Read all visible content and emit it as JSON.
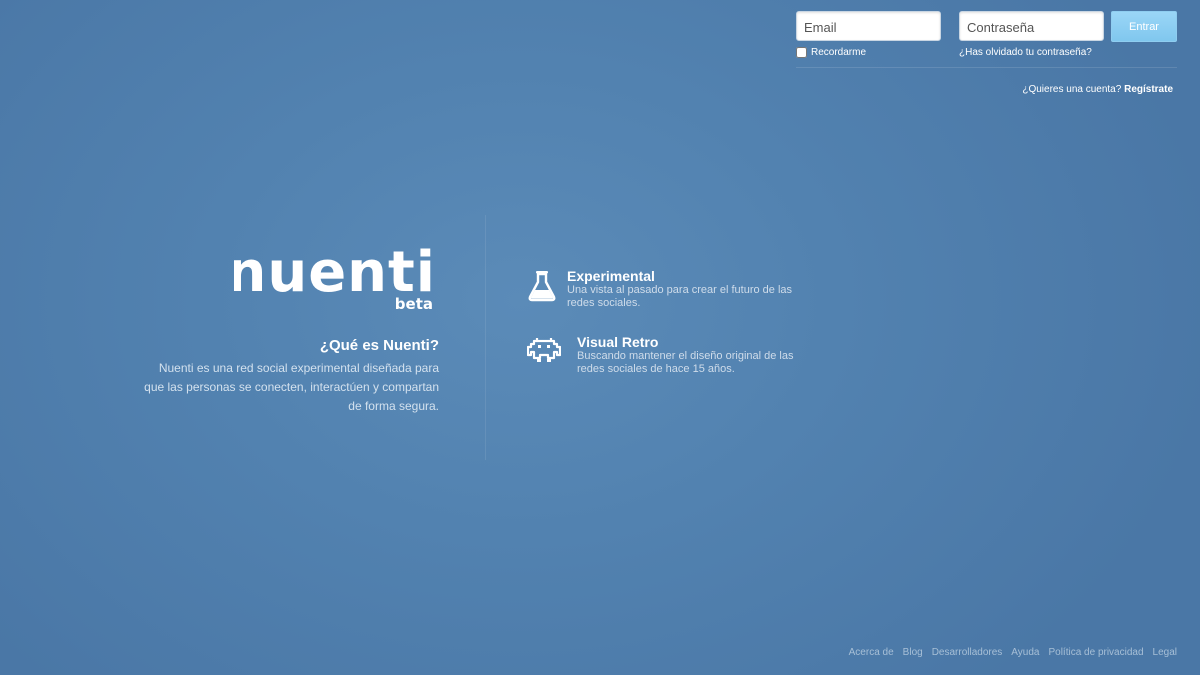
{
  "login": {
    "email_placeholder": "Email",
    "password_placeholder": "Contraseña",
    "submit_label": "Entrar",
    "remember_label": "Recordarme",
    "forgot_label": "¿Has olvidado tu contraseña?",
    "signup_prompt": "¿Quieres una cuenta?",
    "signup_link": "Regístrate"
  },
  "brand": {
    "logo_word": "nuenti",
    "logo_tag": "beta"
  },
  "about": {
    "title": "¿Qué es Nuenti?",
    "text": "Nuenti es una red social experimental diseñada para que las personas se conecten, interactúen y compartan de forma segura."
  },
  "features": [
    {
      "icon": "flask-icon",
      "title": "Experimental",
      "description": "Una vista al pasado para crear el futuro de las redes sociales."
    },
    {
      "icon": "space-invader-icon",
      "title": "Visual Retro",
      "description": "Buscando mantener el diseño original de las redes sociales de hace 15 años."
    }
  ],
  "footer": {
    "links": [
      "Acerca de",
      "Blog",
      "Desarrolladores",
      "Ayuda",
      "Política de privacidad",
      "Legal"
    ]
  },
  "colors": {
    "background": "#5282b0",
    "button": "#8ecff3",
    "footer_link": "#a7bfd6"
  }
}
